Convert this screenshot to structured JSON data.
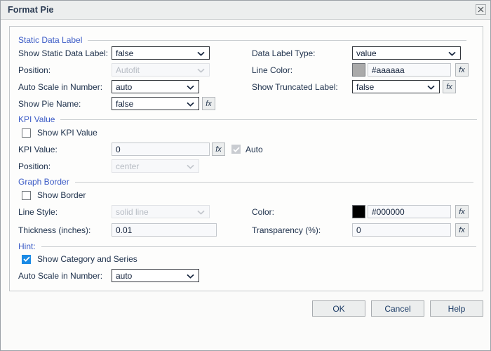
{
  "window": {
    "title": "Format Pie",
    "close_icon": "close-icon"
  },
  "sections": {
    "static_data_label": {
      "heading": "Static Data Label",
      "show_static_data_label": {
        "label": "Show Static Data Label:",
        "value": "false"
      },
      "position": {
        "label": "Position:",
        "value": "Autofit",
        "disabled": true
      },
      "auto_scale_in_number": {
        "label": "Auto Scale in Number:",
        "value": "auto"
      },
      "show_pie_name": {
        "label": "Show Pie Name:",
        "value": "false",
        "fx": "fx"
      },
      "data_label_type": {
        "label": "Data Label Type:",
        "value": "value"
      },
      "line_color": {
        "label": "Line Color:",
        "value": "#aaaaaa",
        "swatch": "#aaaaaa",
        "fx": "fx"
      },
      "show_truncated_label": {
        "label": "Show Truncated Label:",
        "value": "false",
        "fx": "fx"
      }
    },
    "kpi_value": {
      "heading": "KPI Value",
      "show_kpi_value": {
        "label": "Show KPI Value",
        "checked": false
      },
      "kpi_value": {
        "label": "KPI Value:",
        "value": "0",
        "fx": "fx"
      },
      "auto": {
        "label": "Auto",
        "checked": true,
        "disabled": true
      },
      "position": {
        "label": "Position:",
        "value": "center",
        "disabled": true
      }
    },
    "graph_border": {
      "heading": "Graph Border",
      "show_border": {
        "label": "Show Border",
        "checked": false
      },
      "line_style": {
        "label": "Line Style:",
        "value": "solid line",
        "disabled": true
      },
      "thickness": {
        "label": "Thickness (inches):",
        "value": "0.01"
      },
      "color": {
        "label": "Color:",
        "value": "#000000",
        "swatch": "#000000",
        "fx": "fx"
      },
      "transparency": {
        "label": "Transparency (%):",
        "value": "0",
        "fx": "fx"
      }
    },
    "hint": {
      "heading": "Hint:",
      "show_category_and_series": {
        "label": "Show Category and Series",
        "checked": true
      },
      "auto_scale_in_number": {
        "label": "Auto Scale in Number:",
        "value": "auto"
      }
    }
  },
  "footer": {
    "ok": "OK",
    "cancel": "Cancel",
    "help": "Help"
  },
  "colors": {
    "section_heading": "#3b5bc6",
    "checkbox_checked": "#1a8ae5",
    "titlebar_bg": "#eceeee"
  }
}
